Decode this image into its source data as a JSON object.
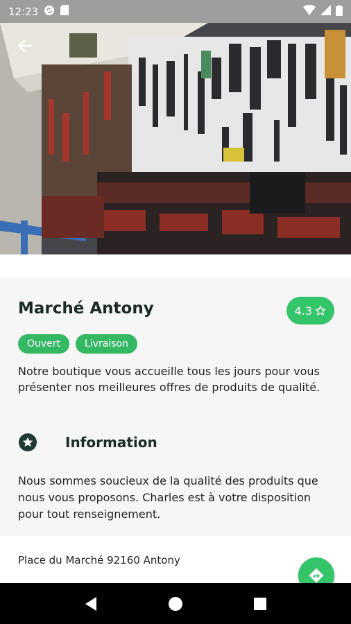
{
  "status_bar": {
    "time": "12:23",
    "icons": [
      "sync-icon",
      "sd-card-icon",
      "wifi-icon",
      "signal-icon",
      "battery-icon"
    ]
  },
  "hero": {
    "image_description_icon": "store-photo",
    "back_icon": "arrow-left-icon"
  },
  "store": {
    "name": "Marché Antony",
    "rating": "4.3",
    "rating_icon": "star-outline-icon",
    "tags": [
      "Ouvert",
      "Livraison"
    ],
    "description": "Notre boutique vous accueille tous les jours pour vous présenter nos meilleures offres de produits de qualité."
  },
  "information": {
    "icon": "star-badge-icon",
    "title": "Information",
    "text": "Nous sommes soucieux de la qualité des produits que nous vous proposons. Charles est à votre disposition pour tout renseignement."
  },
  "address": {
    "text": "Place du Marché 92160 Antony",
    "directions_icon": "directions-icon"
  },
  "nav": {
    "icons": [
      "back-triangle-icon",
      "home-circle-icon",
      "recents-square-icon"
    ]
  },
  "colors": {
    "accent": "#34c46a",
    "chip": "#34b864",
    "text_dark": "#1c2a27",
    "status_bar": "#9e9e9e"
  }
}
